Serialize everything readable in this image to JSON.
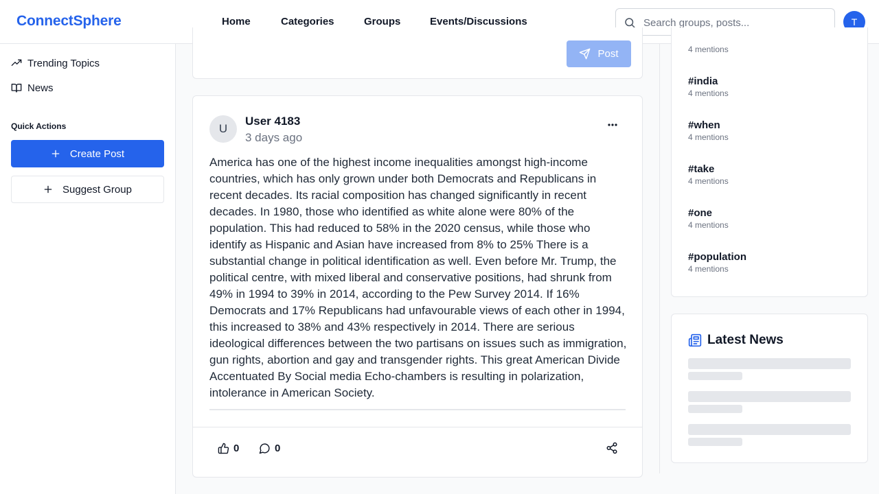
{
  "header": {
    "brand": "ConnectSphere",
    "nav": [
      "Home",
      "Categories",
      "Groups",
      "Events/Discussions"
    ],
    "search_placeholder": "Search groups, posts...",
    "avatar_initial": "T"
  },
  "sidebar": {
    "links": [
      {
        "label": "Trending Topics",
        "icon": "trending-up-icon"
      },
      {
        "label": "News",
        "icon": "book-open-icon"
      }
    ],
    "quick_actions_label": "Quick Actions",
    "create_post": "Create Post",
    "suggest_group": "Suggest Group"
  },
  "composer": {
    "post_label": "Post"
  },
  "post": {
    "avatar_initial": "U",
    "user": "User 4183",
    "time": "3 days ago",
    "body": "America has one of the highest income inequalities amongst high-income countries, which has only grown under both Democrats and Republicans in recent decades. Its racial composition has changed significantly in recent decades. In 1980, those who identified as white alone were 80% of the population. This had reduced to 58% in the 2020 census, while those who identify as Hispanic and Asian have increased from 8% to 25% There is a substantial change in political identification as well. Even before Mr. Trump, the political centre, with mixed liberal and conservative positions, had shrunk from 49% in 1994 to 39% in 2014, according to the Pew Survey 2014. If 16% Democrats and 17% Republicans had unfavourable views of each other in 1994, this increased to 38% and 43% respectively in 2014. There are serious ideological differences between the two partisans on issues such as immigration, gun rights, abortion and gay and transgender rights. This great American Divide Accentuated By Social media Echo-chambers is resulting in polarization, intolerance in American Society.",
    "likes": "0",
    "comments": "0"
  },
  "trending": {
    "first_count": "4 mentions",
    "tags": [
      {
        "tag": "#india",
        "count": "4 mentions"
      },
      {
        "tag": "#when",
        "count": "4 mentions"
      },
      {
        "tag": "#take",
        "count": "4 mentions"
      },
      {
        "tag": "#one",
        "count": "4 mentions"
      },
      {
        "tag": "#population",
        "count": "4 mentions"
      }
    ]
  },
  "news": {
    "title": "Latest News"
  },
  "colors": {
    "accent": "#2563eb",
    "accent_disabled": "#93b4f5",
    "border": "#e5e7eb",
    "muted_text": "#6b7280"
  }
}
